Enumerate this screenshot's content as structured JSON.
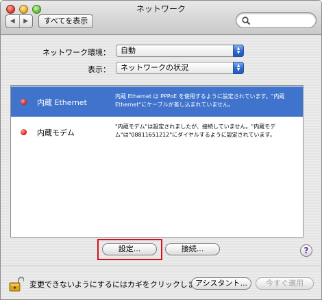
{
  "window": {
    "title": "ネットワーク"
  },
  "toolbar": {
    "back_glyph": "◀",
    "forward_glyph": "▶",
    "show_all_label": "すべてを表示",
    "search_placeholder": ""
  },
  "form": {
    "location_label": "ネットワーク環境：",
    "location_value": "自動",
    "show_label": "表示：",
    "show_value": "ネットワークの状況"
  },
  "services": [
    {
      "name": "内蔵 Ethernet",
      "description": "内蔵 Ethernet は PPPoE を使用するように設定されています。\"内蔵 Ethernet\"にケーブルが差し込まれていません。",
      "selected": true,
      "status_color": "#d82a20"
    },
    {
      "name": "内蔵モデム",
      "description": "\"内蔵モデム\"は設定されましたが、接続していません。\"内蔵モデム\"は\"08811651212\"にダイヤルするように設定されています。",
      "selected": false,
      "status_color": "#d82a20"
    }
  ],
  "actions": {
    "configure_label": "設定...",
    "connect_label": "接続...",
    "help_glyph": "?"
  },
  "footer": {
    "lock_text": "変更できないようにするにはカギをクリックします。",
    "assistant_label": "アシスタント...",
    "apply_label": "今すぐ適用"
  },
  "colors": {
    "selection": "#3f73cc",
    "highlight_box": "#d6101a",
    "status_red": "#d82a20"
  }
}
